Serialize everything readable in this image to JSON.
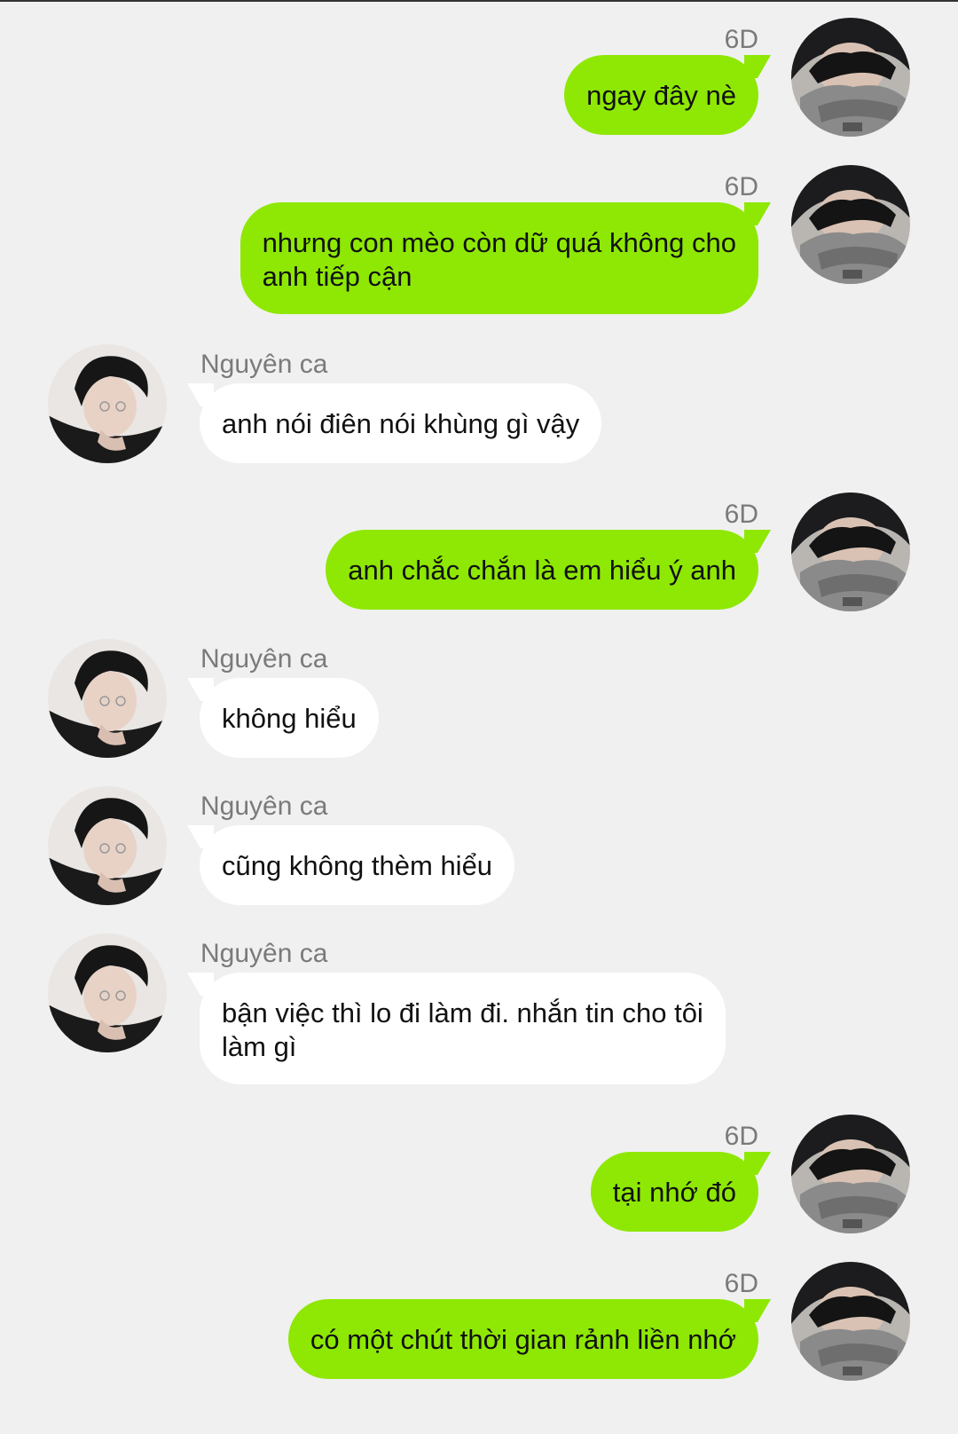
{
  "chat": {
    "messages": [
      {
        "direction": "out",
        "sender": "6D",
        "text": "ngay đây nè"
      },
      {
        "direction": "out",
        "sender": "6D",
        "text": "nhưng con mèo còn dữ quá không cho\nanh tiếp cận"
      },
      {
        "direction": "in",
        "sender": "Nguyên ca",
        "text": "anh nói điên nói khùng gì vậy"
      },
      {
        "direction": "out",
        "sender": "6D",
        "text": "anh chắc chắn là em hiểu ý anh"
      },
      {
        "direction": "in",
        "sender": "Nguyên ca",
        "text": "không hiểu"
      },
      {
        "direction": "in",
        "sender": "Nguyên ca",
        "text": "cũng không thèm hiểu"
      },
      {
        "direction": "in",
        "sender": "Nguyên ca",
        "text": "bận việc thì lo đi làm đi. nhắn tin cho tôi\nlàm gì"
      },
      {
        "direction": "out",
        "sender": "6D",
        "text": "tại nhớ đó"
      },
      {
        "direction": "out",
        "sender": "6D",
        "text": "có một chút thời gian rảnh liền nhớ"
      }
    ]
  },
  "colors": {
    "background": "#f0f0f0",
    "outgoing_bubble": "#8ee803",
    "incoming_bubble": "#ffffff",
    "sender_name": "#7a7a7a"
  }
}
